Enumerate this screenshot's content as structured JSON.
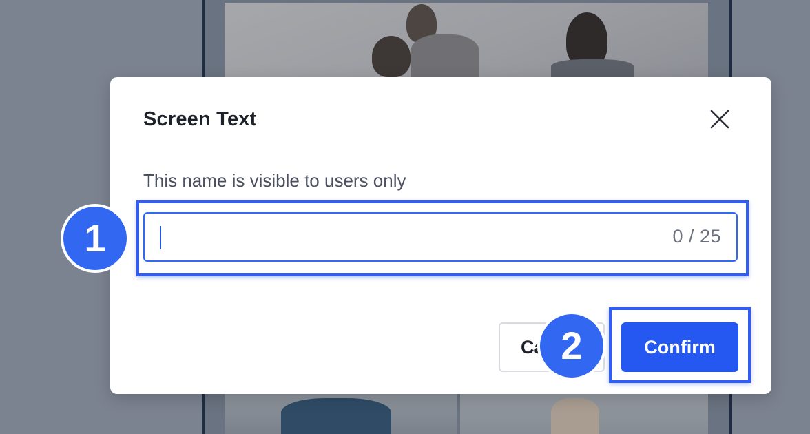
{
  "dialog": {
    "title": "Screen Text",
    "close_icon": "close-icon",
    "field_label": "This name is visible to users only",
    "input": {
      "value": "",
      "placeholder": "",
      "counter": "0 / 25"
    },
    "cancel_label": "Cancel",
    "confirm_label": "Confirm"
  },
  "annotations": {
    "step1": "1",
    "step2": "2"
  },
  "colors": {
    "accent": "#2458f0",
    "highlight": "#2f5df5",
    "badge": "#3267f2",
    "overlay": "#7c8390"
  }
}
